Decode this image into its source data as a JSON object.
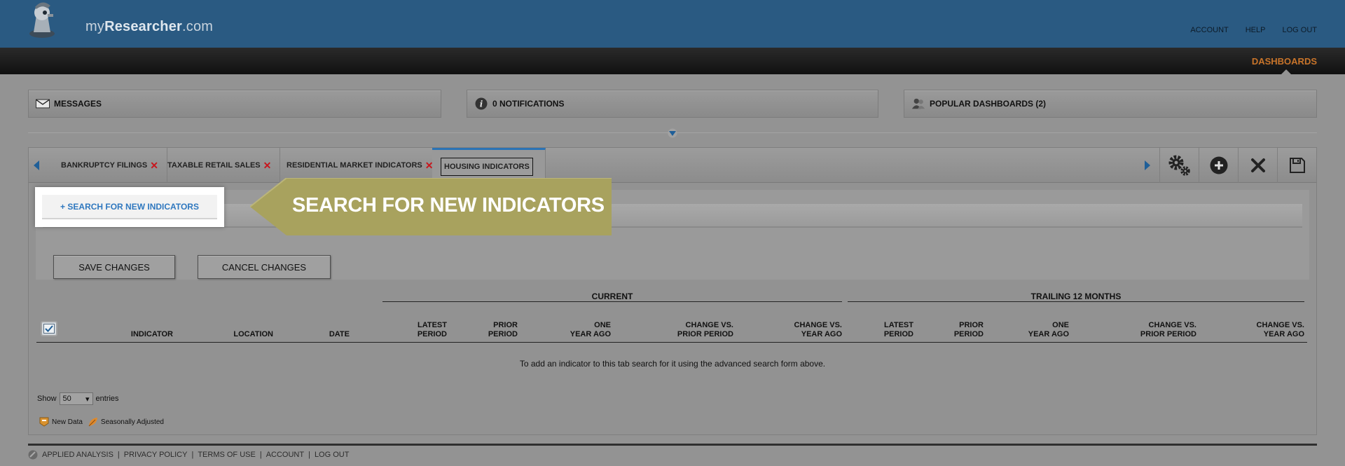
{
  "header": {
    "logo_prefix": "my",
    "logo_bold": "Researcher",
    "logo_suffix": ".com",
    "links": [
      "ACCOUNT",
      "HELP",
      "LOG OUT"
    ]
  },
  "nav": {
    "active": "DASHBOARDS"
  },
  "panels": {
    "messages": "MESSAGES",
    "notifications": "0 NOTIFICATIONS",
    "popular": "POPULAR DASHBOARDS (2)"
  },
  "tabs": [
    {
      "label": "BANKRUPTCY FILINGS"
    },
    {
      "label": "TAXABLE RETAIL SALES"
    },
    {
      "label": "RESIDENTIAL MARKET INDICATORS"
    },
    {
      "label": "HOUSING INDICATORS"
    }
  ],
  "search_link": "+ SEARCH FOR NEW INDICATORS",
  "callout": "SEARCH FOR NEW INDICATORS",
  "buttons": {
    "save": "SAVE CHANGES",
    "cancel": "CANCEL CHANGES"
  },
  "table": {
    "groups": {
      "current": "CURRENT",
      "trailing": "TRAILING 12 MONTHS"
    },
    "columns": {
      "indicator": "INDICATOR",
      "location": "LOCATION",
      "date": "DATE",
      "latest_1": "LATEST",
      "latest_2": "PERIOD",
      "prior_1": "PRIOR",
      "prior_2": "PERIOD",
      "one_1": "ONE",
      "one_2": "YEAR AGO",
      "chgp_1": "CHANGE VS.",
      "chgp_2": "PRIOR PERIOD",
      "chgy_1": "CHANGE VS.",
      "chgy_2": "YEAR AGO"
    },
    "empty_message": "To add an indicator to this tab search for it using the advanced search form above."
  },
  "pagination": {
    "show": "Show",
    "value": "50",
    "entries": "entries"
  },
  "legend": {
    "new_data": "New Data",
    "seasonal": "Seasonally Adjusted"
  },
  "footer": {
    "links": [
      "APPLIED ANALYSIS",
      "PRIVACY POLICY",
      "TERMS OF USE",
      "ACCOUNT",
      "LOG OUT"
    ],
    "separator": "|"
  },
  "colors": {
    "header_blue": "#2a5a82",
    "accent_orange": "#c8742a",
    "callout_olive": "#a8a25e",
    "link_blue": "#2f78bf",
    "close_red": "#c8161d"
  }
}
